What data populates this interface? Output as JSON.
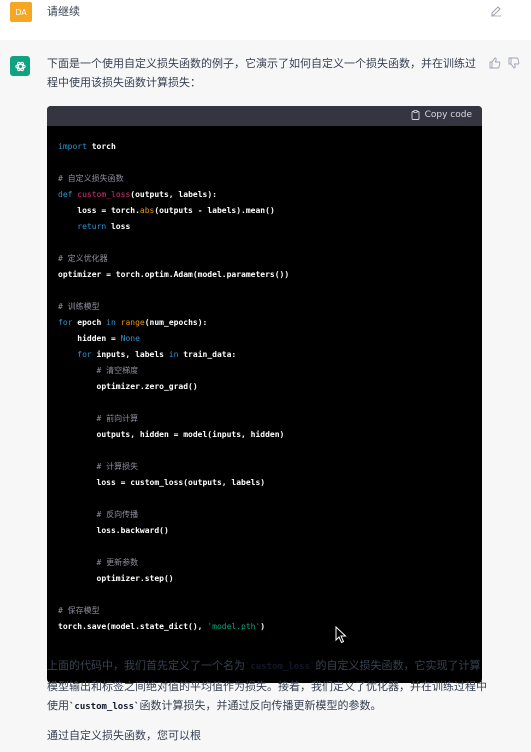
{
  "user": {
    "avatar_initials": "DA",
    "avatar_color": "#f5a623",
    "message": "请继续",
    "edit_icon": "edit-icon"
  },
  "assistant": {
    "avatar_icon": "openai-logo-icon",
    "avatar_color": "#10a37f",
    "intro": "下面是一个使用自定义损失函数的例子，它演示了如何自定义一个损失函数，并在训练过程中使用该损失函数计算损失：",
    "copy_label": "Copy code",
    "code_lines": [
      [
        [
          "kw",
          "import"
        ],
        [
          "p",
          " torch"
        ]
      ],
      [
        [
          "p",
          ""
        ]
      ],
      [
        [
          "cm",
          "# 自定义损失函数"
        ]
      ],
      [
        [
          "kw",
          "def"
        ],
        [
          "p",
          " "
        ],
        [
          "fn",
          "custom_loss"
        ],
        [
          "p",
          "(outputs, labels):"
        ]
      ],
      [
        [
          "p",
          "    loss = torch."
        ],
        [
          "bi",
          "abs"
        ],
        [
          "p",
          "(outputs - labels).mean()"
        ]
      ],
      [
        [
          "p",
          "    "
        ],
        [
          "kw",
          "return"
        ],
        [
          "p",
          " loss"
        ]
      ],
      [
        [
          "p",
          ""
        ]
      ],
      [
        [
          "cm",
          "# 定义优化器"
        ]
      ],
      [
        [
          "p",
          "optimizer = torch.optim.Adam(model.parameters())"
        ]
      ],
      [
        [
          "p",
          ""
        ]
      ],
      [
        [
          "cm",
          "# 训练模型"
        ]
      ],
      [
        [
          "kw",
          "for"
        ],
        [
          "p",
          " epoch "
        ],
        [
          "kw",
          "in"
        ],
        [
          "p",
          " "
        ],
        [
          "bi",
          "range"
        ],
        [
          "p",
          "(num_epochs):"
        ]
      ],
      [
        [
          "p",
          "    hidden = "
        ],
        [
          "kw",
          "None"
        ]
      ],
      [
        [
          "p",
          "    "
        ],
        [
          "kw",
          "for"
        ],
        [
          "p",
          " inputs, labels "
        ],
        [
          "kw",
          "in"
        ],
        [
          "p",
          " train_data:"
        ]
      ],
      [
        [
          "p",
          "        "
        ],
        [
          "cm",
          "# 清空梯度"
        ]
      ],
      [
        [
          "p",
          "        optimizer.zero_grad()"
        ]
      ],
      [
        [
          "p",
          ""
        ]
      ],
      [
        [
          "p",
          "        "
        ],
        [
          "cm",
          "# 前向计算"
        ]
      ],
      [
        [
          "p",
          "        outputs, hidden = model(inputs, hidden)"
        ]
      ],
      [
        [
          "p",
          ""
        ]
      ],
      [
        [
          "p",
          "        "
        ],
        [
          "cm",
          "# 计算损失"
        ]
      ],
      [
        [
          "p",
          "        loss = custom_loss(outputs, labels)"
        ]
      ],
      [
        [
          "p",
          ""
        ]
      ],
      [
        [
          "p",
          "        "
        ],
        [
          "cm",
          "# 反向传播"
        ]
      ],
      [
        [
          "p",
          "        loss.backward()"
        ]
      ],
      [
        [
          "p",
          ""
        ]
      ],
      [
        [
          "p",
          "        "
        ],
        [
          "cm",
          "# 更新参数"
        ]
      ],
      [
        [
          "p",
          "        optimizer.step()"
        ]
      ],
      [
        [
          "p",
          ""
        ]
      ],
      [
        [
          "cm",
          "# 保存模型"
        ]
      ],
      [
        [
          "p",
          "torch.save(model.state_dict(), "
        ],
        [
          "str",
          "'model.pth'"
        ],
        [
          "p",
          ")"
        ]
      ]
    ],
    "para1": [
      [
        "t",
        "上面的代码中，我们首先定义了一个名为"
      ],
      [
        "c",
        "`custom_loss`"
      ],
      [
        "t",
        "的自定义损失函数，它实现了计算模型输出和标签之间绝对值的平均值作为损失。接着，我们定义了优化器，并在训练过程中使用"
      ],
      [
        "c",
        "`custom_loss`"
      ],
      [
        "t",
        "函数计算损失，并通过反向传播更新模型的参数。"
      ]
    ],
    "para2": "通过自定义损失函数，您可以根",
    "thumb_up_icon": "thumb-up-icon",
    "thumb_down_icon": "thumb-down-icon"
  },
  "colors": {
    "user_bg": "#ffffff",
    "assistant_bg": "#f7f7f8",
    "code_bg": "#000000",
    "code_header_bg": "#343541",
    "keyword": "#2e95d3",
    "function": "#df3079",
    "builtin": "#e9950c",
    "string": "#00a67d",
    "comment": "#8f8f9f"
  }
}
